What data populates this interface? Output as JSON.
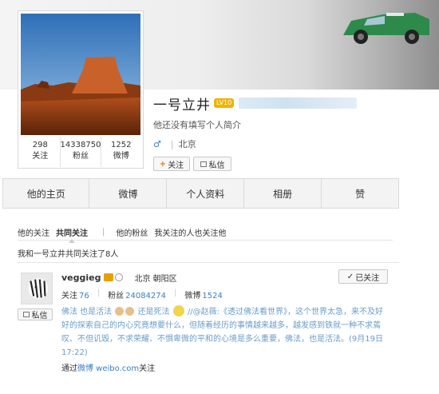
{
  "profile": {
    "name": "一号立井",
    "level_badge": "LV10",
    "bio": "他还没有填写个人简介",
    "gender_icon": "male-icon",
    "location": "北京",
    "follow_button": "关注",
    "message_button": "私信",
    "stats": [
      {
        "value": "298",
        "label": "关注"
      },
      {
        "value": "14338750",
        "label": "粉丝"
      },
      {
        "value": "1252",
        "label": "微博"
      }
    ]
  },
  "nav": {
    "tabs": [
      "他的主页",
      "微博",
      "个人资料",
      "相册",
      "赞"
    ]
  },
  "subtabs": {
    "his_following": "他的关注",
    "common_following": "共同关注",
    "separator": "|",
    "his_fans": "他的粉丝",
    "my_following_also": "我关注的人也关注他"
  },
  "common_line": "我和一号立井共同关注了8人",
  "entry": {
    "name": "veggieg",
    "location": "北京 朝阳区",
    "following_label": "关注",
    "following_value": "76",
    "fans_label": "粉丝",
    "fans_value": "24084274",
    "weibo_label": "微博",
    "weibo_value": "1524",
    "followed_button": "已关注",
    "message_button": "私信",
    "post_part1": "佛法 也是活法",
    "post_part2": "还是死法",
    "post_part3": "//@赵薇:《透过佛法看世界》，这个世界太急，来不及好好的探索自己的内心究竟想要什么，但随着经历的事情越来越多，越发感到铁就一种不求蔫叹、不但讥毁，不求荣耀、不惧卑微的平和的心境是多么重要，佛法，也是活法。(9月19日 17:22)",
    "via_prefix": "通过",
    "via_link": "微博 weibo.com",
    "via_suffix": "关注"
  },
  "colors": {
    "link_blue": "#3a7fc1",
    "post_text": "#6a9cc9",
    "badge_gold": "#f0b400",
    "nav_bg": "#f3f3f3"
  }
}
